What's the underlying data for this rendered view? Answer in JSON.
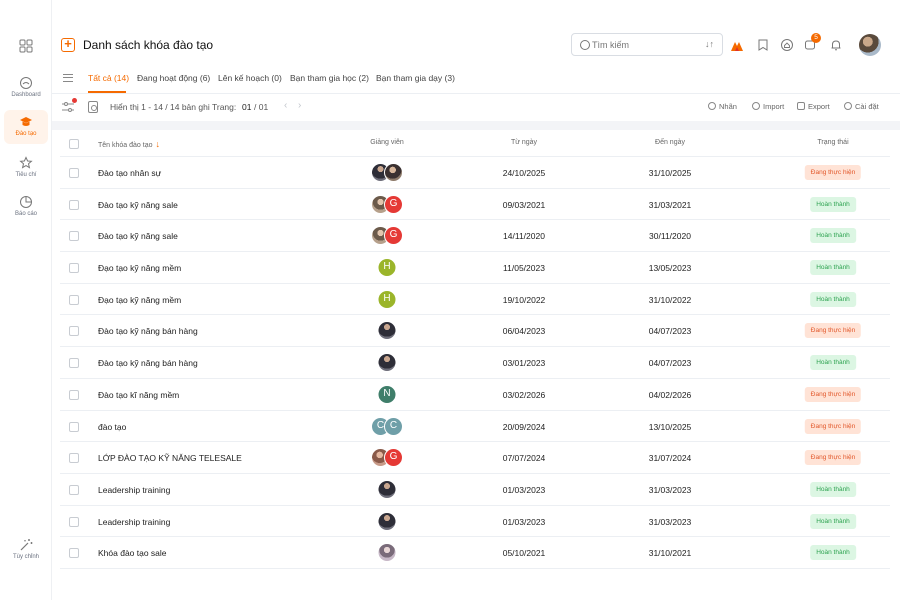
{
  "sidebar": {
    "items": [
      {
        "label": "Dashboard",
        "icon": "dashboard-icon"
      },
      {
        "label": "Đào tạo",
        "icon": "graduation-cap-icon",
        "active": true
      },
      {
        "label": "Tiêu chí",
        "icon": "star-icon"
      },
      {
        "label": "Báo cáo",
        "icon": "pie-chart-icon"
      },
      {
        "label": "Tùy chỉnh",
        "icon": "magic-wand-icon"
      }
    ]
  },
  "header": {
    "title": "Danh sách khóa đào tạo",
    "search_placeholder": "Tìm kiếm",
    "sort_label": "↓↑",
    "notification_count": "5",
    "accent_color": "#f56a00"
  },
  "tabs": [
    {
      "label": "Tất cả (14)",
      "active": true
    },
    {
      "label": "Đang hoạt động (6)"
    },
    {
      "label": "Lên kế hoạch (0)"
    },
    {
      "label": "Bạn tham gia học (2)"
    },
    {
      "label": "Bạn tham gia dạy (3)"
    }
  ],
  "toolbar": {
    "records_info": "Hiển thị 1 - 14 / 14 bản ghi",
    "page_label": "Trang:",
    "page_current": "01",
    "page_total": "/ 01",
    "prev": "‹",
    "next": "›",
    "actions": [
      {
        "label": "Nhãn",
        "icon": "tag-icon"
      },
      {
        "label": "Import",
        "icon": "import-icon"
      },
      {
        "label": "Export",
        "icon": "export-icon"
      },
      {
        "label": "Cài đặt",
        "icon": "settings-icon"
      }
    ]
  },
  "table": {
    "columns": {
      "name": "Tên khóa đào tạo",
      "sort_indicator": "↓",
      "instructor": "Giảng viên",
      "from": "Từ ngày",
      "to": "Đến ngày",
      "status": "Trạng thái"
    },
    "rows": [
      {
        "name": "Đào tạo nhân sự",
        "avatars": [
          {
            "type": "photo-c",
            "text": ""
          },
          {
            "type": "photo-a",
            "text": ""
          }
        ],
        "from": "24/10/2025",
        "to": "31/10/2025",
        "status": "Đang thực hiện",
        "status_type": "prog"
      },
      {
        "name": "Đào tạo kỹ năng sale",
        "avatars": [
          {
            "type": "photo-b",
            "text": ""
          },
          {
            "type": "#e53935",
            "text": "G"
          }
        ],
        "from": "09/03/2021",
        "to": "31/03/2021",
        "status": "Hoàn thành",
        "status_type": "done"
      },
      {
        "name": "Đào tạo kỹ năng sale",
        "avatars": [
          {
            "type": "photo-b",
            "text": ""
          },
          {
            "type": "#e53935",
            "text": "G"
          }
        ],
        "from": "14/11/2020",
        "to": "30/11/2020",
        "status": "Hoàn thành",
        "status_type": "done"
      },
      {
        "name": "Đạo tạo kỹ năng mềm",
        "avatars": [
          {
            "type": "#9bb52a",
            "text": "H"
          }
        ],
        "from": "11/05/2023",
        "to": "13/05/2023",
        "status": "Hoàn thành",
        "status_type": "done"
      },
      {
        "name": "Đạo tạo kỹ năng mềm",
        "avatars": [
          {
            "type": "#9bb52a",
            "text": "H"
          }
        ],
        "from": "19/10/2022",
        "to": "31/10/2022",
        "status": "Hoàn thành",
        "status_type": "done"
      },
      {
        "name": "Đào tạo kỹ năng bán hàng",
        "avatars": [
          {
            "type": "photo-c",
            "text": ""
          }
        ],
        "from": "06/04/2023",
        "to": "04/07/2023",
        "status": "Đang thực hiện",
        "status_type": "prog"
      },
      {
        "name": "Đào tạo kỹ năng bán hàng",
        "avatars": [
          {
            "type": "photo-c",
            "text": ""
          }
        ],
        "from": "03/01/2023",
        "to": "04/07/2023",
        "status": "Hoàn thành",
        "status_type": "done"
      },
      {
        "name": "Đào tạo kĩ năng mềm",
        "avatars": [
          {
            "type": "#3f7e6a",
            "text": "N"
          }
        ],
        "from": "03/02/2026",
        "to": "04/02/2026",
        "status": "Đang thực hiện",
        "status_type": "prog"
      },
      {
        "name": "đào tạo",
        "avatars": [
          {
            "type": "#6f9fa8",
            "text": "C"
          },
          {
            "type": "#6f9fa8",
            "text": "C"
          }
        ],
        "from": "20/09/2024",
        "to": "13/10/2025",
        "status": "Đang thực hiện",
        "status_type": "prog"
      },
      {
        "name": "LỚP ĐÀO TẠO KỸ NĂNG TELESALE",
        "avatars": [
          {
            "type": "photo-e",
            "text": ""
          },
          {
            "type": "#e53935",
            "text": "G"
          }
        ],
        "from": "07/07/2024",
        "to": "31/07/2024",
        "status": "Đang thực hiện",
        "status_type": "prog"
      },
      {
        "name": "Leadership training",
        "avatars": [
          {
            "type": "photo-c",
            "text": ""
          }
        ],
        "from": "01/03/2023",
        "to": "31/03/2023",
        "status": "Hoàn thành",
        "status_type": "done"
      },
      {
        "name": "Leadership training",
        "avatars": [
          {
            "type": "photo-c",
            "text": ""
          }
        ],
        "from": "01/03/2023",
        "to": "31/03/2023",
        "status": "Hoàn thành",
        "status_type": "done"
      },
      {
        "name": "Khóa đào tạo sale",
        "avatars": [
          {
            "type": "photo-d",
            "text": ""
          }
        ],
        "from": "05/10/2021",
        "to": "31/10/2021",
        "status": "Hoàn thành",
        "status_type": "done"
      }
    ]
  }
}
